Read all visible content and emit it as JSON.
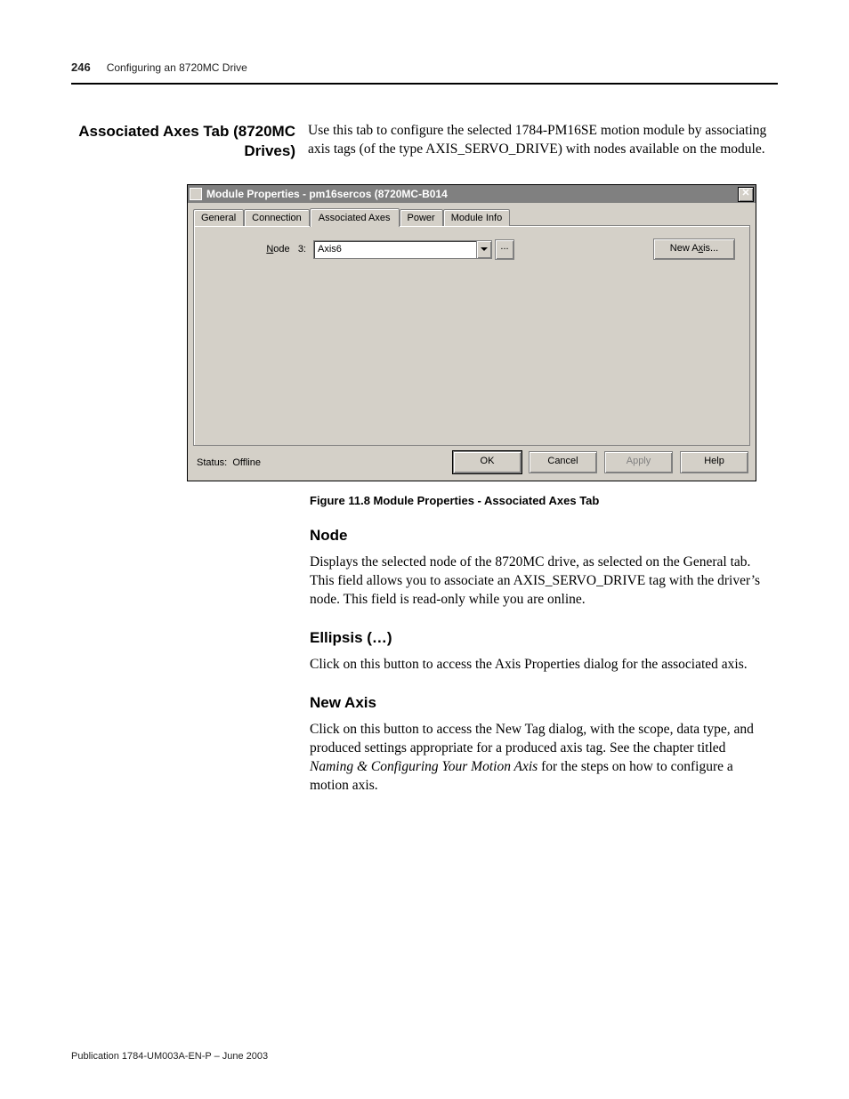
{
  "header": {
    "page_number": "246",
    "chapter": "Configuring an 8720MC Drive"
  },
  "section_heading_lines": [
    "Associated Axes Tab (8720MC",
    "Drives)"
  ],
  "intro_paragraph": "Use this tab to configure the selected 1784-PM16SE motion module by associating axis tags (of the type AXIS_SERVO_DRIVE) with nodes available on the module.",
  "dialog": {
    "title": "Module Properties - pm16sercos (8720MC-B014",
    "close_glyph": "✕",
    "tabs": {
      "general": "General",
      "connection": "Connection",
      "associated_axes": "Associated Axes",
      "power": "Power",
      "module_info": "Module Info"
    },
    "node_label_prefix": "N",
    "node_label_rest": "ode   3:",
    "combo_value": "Axis6",
    "ellipsis_label": "...",
    "new_axis_label": "New A",
    "new_axis_underlined": "x",
    "new_axis_suffix": "is...",
    "status_text": "Status:  Offline",
    "buttons": {
      "ok": "OK",
      "cancel": "Cancel",
      "apply": "Apply",
      "help": "Help"
    }
  },
  "figure_caption": "Figure 11.8 Module Properties - Associated Axes Tab",
  "sections": {
    "node": {
      "heading": "Node",
      "body": "Displays the selected node of the 8720MC drive, as selected on the General tab. This field allows you to associate an AXIS_SERVO_DRIVE tag with the driver’s node. This field is read-only while you are online."
    },
    "ellipsis": {
      "heading": "Ellipsis (…)",
      "body": "Click on this button to access the Axis Properties dialog for the associated axis."
    },
    "new_axis": {
      "heading": "New Axis",
      "body_prefix": "Click on this button to access the New Tag dialog, with the scope, data type, and produced settings appropriate for a produced axis tag. See the chapter titled ",
      "body_italic": "Naming & Configuring Your Motion Axis",
      "body_suffix": " for the steps on how to configure a motion axis."
    }
  },
  "publication_footer": "Publication 1784-UM003A-EN-P – June 2003"
}
